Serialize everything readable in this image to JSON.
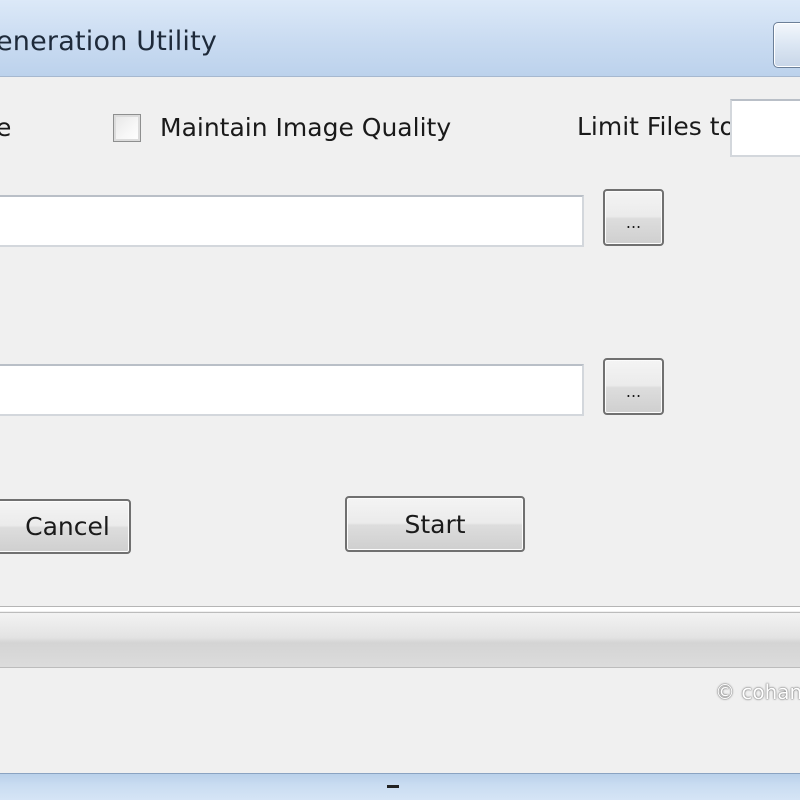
{
  "window": {
    "title": "eneration Utility"
  },
  "options": {
    "left_label_fragment": "e",
    "maintain_quality_label": "Maintain Image Quality",
    "maintain_quality_checked": false,
    "limit_files_label": "Limit Files to",
    "limit_files_value": ""
  },
  "source": {
    "path_value": "",
    "browse_label": "..."
  },
  "destination": {
    "path_value": "",
    "browse_label": "..."
  },
  "actions": {
    "cancel_label": "Cancel",
    "start_label": "Start"
  },
  "progress": {
    "value": 0
  },
  "footer": {
    "copyright_fragment": "© cohan"
  }
}
